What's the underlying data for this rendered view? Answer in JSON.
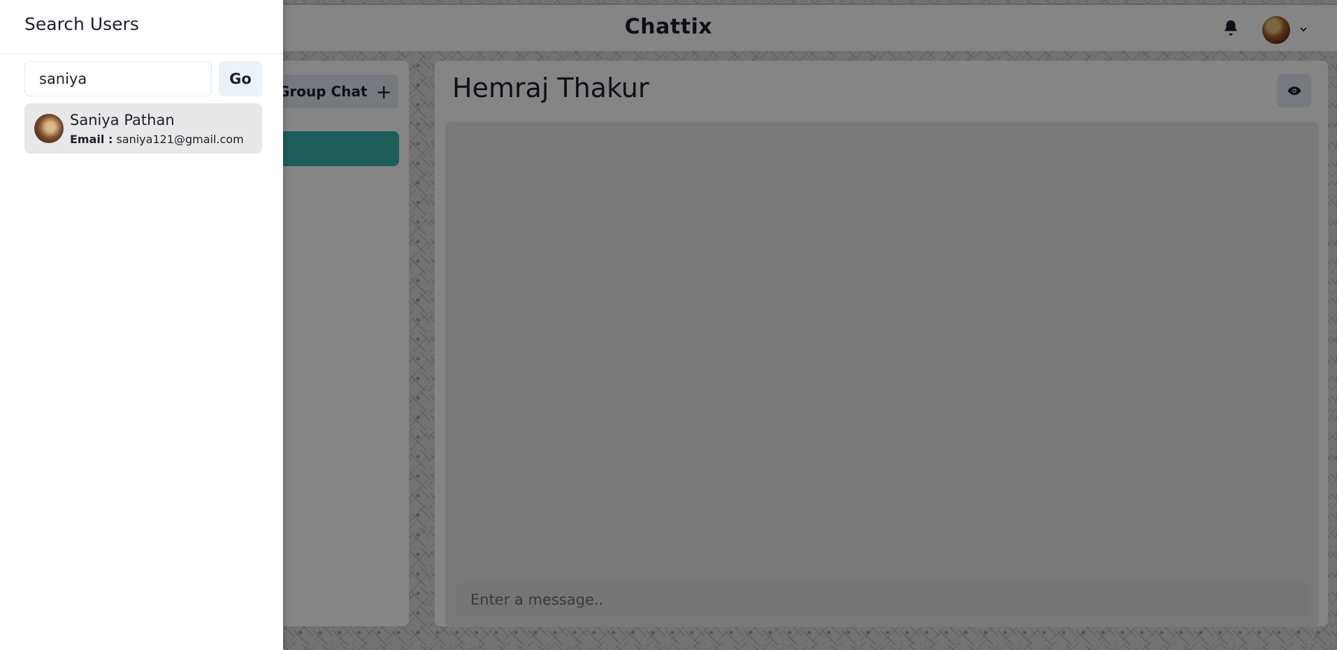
{
  "header": {
    "brand": "Chattix",
    "notification_icon": "bell-icon",
    "profile_menu_icon": "chevron-down-icon"
  },
  "sidebar": {
    "group_chat_button_label": "Group Chat",
    "group_chat_icon": "plus-icon"
  },
  "chat": {
    "title": "Hemraj Thakur",
    "view_profile_icon": "eye-icon",
    "message_placeholder": "Enter a message.."
  },
  "drawer": {
    "title": "Search Users",
    "search_value": "saniya",
    "go_label": "Go",
    "results": [
      {
        "name": "Saniya Pathan",
        "email_label": "Email :",
        "email": "saniya121@gmail.com"
      }
    ]
  },
  "colors": {
    "accent": "#38b2ac",
    "overlay": "rgba(0,0,0,0.48)"
  }
}
